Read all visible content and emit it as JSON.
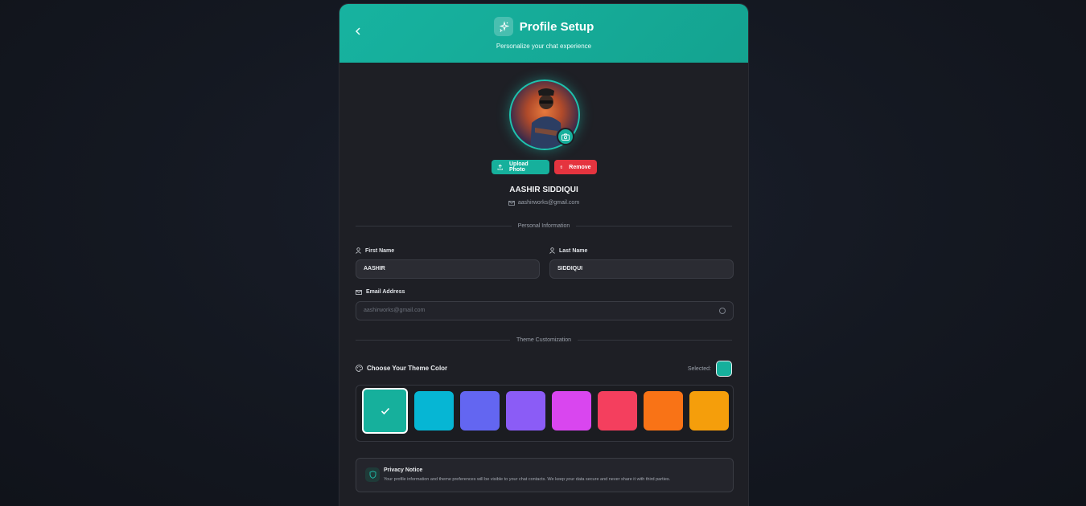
{
  "header": {
    "back_icon": "chevron-left-icon",
    "title": "Profile Setup",
    "subtitle": "Personalize your chat experience"
  },
  "profile": {
    "name": "AASHIR SIDDIQUI",
    "email": "aashirworks@gmail.com",
    "upload_label": "Upload Photo",
    "remove_label": "Remove"
  },
  "sections": {
    "personal": "Personal Information",
    "theme": "Theme Customization"
  },
  "form": {
    "first_name_label": "First Name",
    "first_name_value": "AASHIR",
    "last_name_label": "Last Name",
    "last_name_value": "SIDDIQUI",
    "email_label": "Email Address",
    "email_value": "aashirworks@gmail.com"
  },
  "theme": {
    "label": "Choose Your Theme Color",
    "selected_label": "Selected:",
    "selected_color": "#16b09c",
    "swatches": [
      "#16b09c",
      "#06b6d4",
      "#6366f1",
      "#8b5cf6",
      "#d946ef",
      "#f43f5e",
      "#f97316",
      "#f59e0b"
    ]
  },
  "privacy": {
    "title": "Privacy Notice",
    "text": "Your profile information and theme preferences will be visible to your chat contacts. We keep your data secure and never share it with third parties."
  }
}
